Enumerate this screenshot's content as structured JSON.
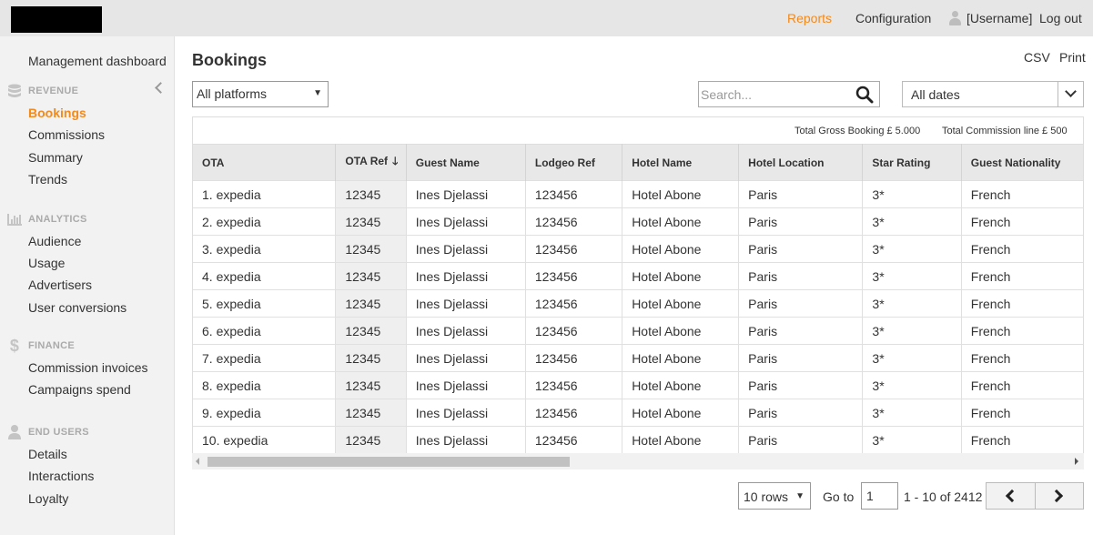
{
  "header": {
    "nav": {
      "reports": "Reports",
      "configuration": "Configuration",
      "username": "[Username]",
      "logout": "Log out"
    },
    "accent_color": "#f28a1c"
  },
  "sidebar": {
    "top_item": "Management dashboard",
    "sections": [
      {
        "title": "REVENUE",
        "icon": "database-icon",
        "items": [
          "Bookings",
          "Commissions",
          "Summary",
          "Trends"
        ]
      },
      {
        "title": "ANALYTICS",
        "icon": "bar-chart-icon",
        "items": [
          "Audience",
          "Usage",
          "Advertisers",
          "User conversions"
        ]
      },
      {
        "title": "FINANCE",
        "icon": "dollar-icon",
        "items": [
          "Commission invoices",
          "Campaigns spend"
        ]
      },
      {
        "title": "END USERS",
        "icon": "user-icon",
        "items": [
          "Details",
          "Interactions",
          "Loyalty"
        ]
      }
    ],
    "active_item": "Bookings"
  },
  "main": {
    "title": "Bookings",
    "csv": "CSV",
    "print": "Print",
    "platform_select": "All platforms",
    "search_placeholder": "Search...",
    "dates_select": "All dates",
    "totals": {
      "gross_booking": "Total Gross Booking  £ 5.000",
      "commission_line": "Total Commission line  £ 500"
    },
    "columns": [
      "OTA",
      "OTA Ref",
      "Guest Name",
      "Lodgeo Ref",
      "Hotel Name",
      "Hotel Location",
      "Star Rating",
      "Guest Nationality"
    ],
    "rows": [
      [
        "1. expedia",
        "12345",
        "Ines Djelassi",
        "123456",
        "Hotel Abone",
        "Paris",
        "3*",
        "French"
      ],
      [
        "2. expedia",
        "12345",
        "Ines Djelassi",
        "123456",
        "Hotel Abone",
        "Paris",
        "3*",
        "French"
      ],
      [
        "3. expedia",
        "12345",
        "Ines Djelassi",
        "123456",
        "Hotel Abone",
        "Paris",
        "3*",
        "French"
      ],
      [
        "4. expedia",
        "12345",
        "Ines Djelassi",
        "123456",
        "Hotel Abone",
        "Paris",
        "3*",
        "French"
      ],
      [
        "5. expedia",
        "12345",
        "Ines Djelassi",
        "123456",
        "Hotel Abone",
        "Paris",
        "3*",
        "French"
      ],
      [
        "6. expedia",
        "12345",
        "Ines Djelassi",
        "123456",
        "Hotel Abone",
        "Paris",
        "3*",
        "French"
      ],
      [
        "7. expedia",
        "12345",
        "Ines Djelassi",
        "123456",
        "Hotel Abone",
        "Paris",
        "3*",
        "French"
      ],
      [
        "8. expedia",
        "12345",
        "Ines Djelassi",
        "123456",
        "Hotel Abone",
        "Paris",
        "3*",
        "French"
      ],
      [
        "9. expedia",
        "12345",
        "Ines Djelassi",
        "123456",
        "Hotel Abone",
        "Paris",
        "3*",
        "French"
      ],
      [
        "10. expedia",
        "12345",
        "Ines Djelassi",
        "123456",
        "Hotel Abone",
        "Paris",
        "3*",
        "French"
      ]
    ]
  },
  "pagination": {
    "rows_select": "10 rows",
    "goto_label": "Go to",
    "goto_value": "1",
    "range": "1 - 10 of 2412"
  }
}
